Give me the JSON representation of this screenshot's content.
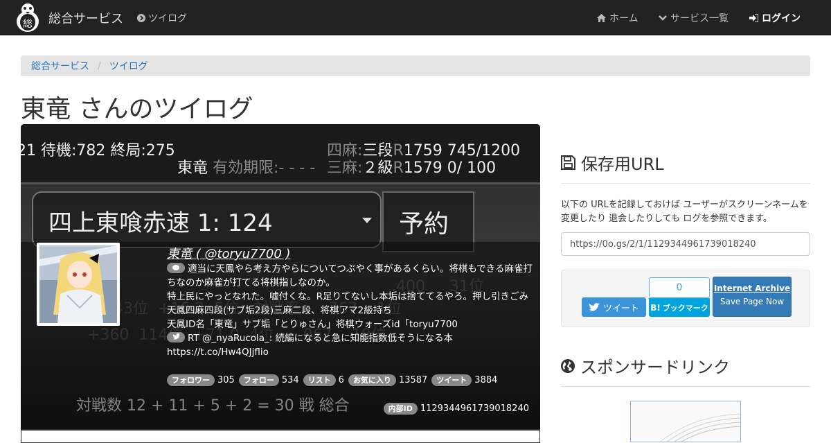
{
  "navbar": {
    "brand": "総合サービス",
    "logo_char": "総",
    "left_item": "ツイログ",
    "home": "ホーム",
    "services": "サービス一覧",
    "login": "ログイン"
  },
  "breadcrumb": [
    "総合サービス",
    "ツイログ"
  ],
  "page_title": "東竜 さんのツイログ",
  "card": {
    "bg_lines": {
      "top_left": "21 待機:782 終局:275",
      "sanma_label": "四麻:",
      "sanma_rank": "三段",
      "sanma_stats": "1759 745/1200",
      "name": "東竜",
      "expiry": "有効期限:- - - -",
      "sanma2_label": "三麻:",
      "sanma2_rank": "２級",
      "sanma2_stats": "1579    0/  100",
      "game_room": "四上東喰赤速  1: 124",
      "reserve": "予約",
      "bottom": "対戦数   12 + 11 + 5 + 2 = 30 戦   総合"
    },
    "user_name": "東竜 ( @toryu7700 )",
    "bio_lines": [
      "適当に天鳳やら考え方やらについてつぶやく事があるくらい。将棋もできる麻雀打ちなのか麻雀が打てる将棋指しなのか。",
      "特上民にやっとなれた。嘘付くな。R足りてないし本垢は捨ててるやろ。押し引きごみ",
      "天鳳四麻四段(サブ垢2段)三麻二段、将棋アマ2級持ち",
      "天鳳ID名「東竜」サブ垢「とりゅさん」将棋ウォーズid「toryu7700"
    ],
    "retweet": "RT @_nyaRucola_: 続編になると急に知能指数低そうになる本 https://t.co/Hw4QJjflio",
    "stats": [
      {
        "label": "フォロワー",
        "value": "305"
      },
      {
        "label": "フォロー",
        "value": "534"
      },
      {
        "label": "リスト",
        "value": "6"
      },
      {
        "label": "お気に入り",
        "value": "13587"
      },
      {
        "label": "ツイート",
        "value": "3884"
      }
    ],
    "internal_label": "内部ID",
    "internal_id": "1129344961739018240"
  },
  "sidebar": {
    "save_heading": "保存用URL",
    "save_desc": "以下の URLを記録しておけば ユーザーがスクリーンネームを変更したり 退会したりしても ログを参照できます。",
    "save_url": "https://0o.gs/2/1/1129344961739018240",
    "tweet_label": "ツイート",
    "hatena_count": "0",
    "hatena_label": "ブックマーク",
    "ia_title": "Internet Archive",
    "ia_sub": "Save Page Now",
    "sponsor_heading": "スポンサードリンク"
  }
}
